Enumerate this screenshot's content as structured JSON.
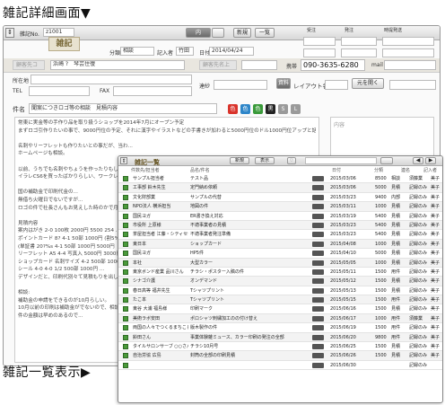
{
  "captions": {
    "detail": "雑記詳細画面▼",
    "list": "雑記一覧表示▶"
  },
  "detail": {
    "no_label": "雑記No.",
    "no_value": "z1001",
    "kind": "雑記",
    "buttons": {
      "b1": "内",
      "b2": "",
      "new": "新規",
      "list": "一覧"
    },
    "top_labels": {
      "juchu": "受注",
      "hatchu": "発注",
      "sakusei": "時提発送"
    },
    "bunrui_label": "分類",
    "bunrui_value": "相談",
    "kinyusha_label": "記入者",
    "kinyusha_value": "竹田",
    "date_label": "日付",
    "date_value": "2014/04/24",
    "customer_placeholder": "顧客先コ",
    "person_name": "浜崎 ?　琴芸住復",
    "addr_placeholder": "顧客先名上",
    "phone_label": "携帯",
    "phone_value": "090-3635-6280",
    "mail_label": "mail",
    "address_label": "所在地",
    "tel_label": "TEL",
    "fax_label": "FAX",
    "teiban_label": "達紗",
    "btn_shiryo": "資料",
    "layout_label": "レイアウト名",
    "btn_open": "元を開く",
    "subject_label": "件名",
    "subject_value": "聞案につきロゴ等の相談　見積内容",
    "memo_label": "内容",
    "colors": [
      {
        "label": "色",
        "hex": "#d9332b"
      },
      {
        "label": "色",
        "hex": "#2e86c9"
      },
      {
        "label": "色",
        "hex": "#3a9a3a"
      },
      {
        "label": "黒",
        "hex": "#222222"
      },
      {
        "label": "S",
        "hex": "#9a9a9a"
      },
      {
        "label": "L",
        "hex": "#9a9a9a"
      }
    ],
    "body_lines": [
      "常東に実金等の手作り品を取り扱うショップを2014年7月にオープン予定",
      "まずロゴ引作りたいの事で、9000円位の予定、それに漢字やイラストなどの手書きが加わると5000円位のドル1000円位アップと話した。",
      "",
      "名刺やリーフレットも作りたいとの事だが、当わ...",
      "ホームページも相談。",
      "",
      "以前、うちでも名刺やちょうを作ったりもし...",
      "イラレCS6を買ったばかりらしい、ワークレセ...",
      "",
      "国の補助金で印刷代金の...",
      "無借ち火曜日でないですが...",
      "ロゴの件で社長さんもお見えした時のかで月...",
      "",
      "見積内容",
      "案内はがき  2-0  100枚  2000円    5500   254 .",
      "ポイントカード  8?  4-1  50部  1000円  (割5%)",
      "(単証書  20?%s  4-1  50部  1000円  5000円",
      "リーフレット  A5  4-4  写真入  5000円  3000円",
      "ショップカード  名刺サイズ  4-2  500部  1000円",
      "シール  4-0  4-0 1/2  500部  1000円 ...",
      "デザインだと、印刷代別々て見積もりを出して...",
      "",
      "相談:",
      "補助金の申請をできるのが10月らしい。",
      "10月以前の印刷は補助金がでないので、相談...",
      "件の金額は早めのあるので..."
    ]
  },
  "list": {
    "title": "雑記一覧",
    "new_button": "新規",
    "detail_button": "表示",
    "columns": [
      "件数先/担当者",
      "品名/件名",
      "日付",
      "分類",
      "連名",
      "記入者"
    ],
    "rows": [
      {
        "c1": "サンプル担当者",
        "c2": "テスト品",
        "date": "2015/03/06",
        "bunrui": "8500",
        "type": "相談",
        "person": "須藤業",
        "extra": "美子"
      },
      {
        "c1": "工事部  鈴木先生",
        "c2": "定門納め依頼",
        "date": "2015/03/06",
        "bunrui": "5000",
        "type": "見積",
        "person": "記録のみ",
        "extra": "美子"
      },
      {
        "c1": "文化財部業",
        "c2": "サンプルの代替",
        "date": "2015/03/23",
        "bunrui": "9400",
        "type": "内部",
        "person": "記録のみ",
        "extra": "美子"
      },
      {
        "c1": "NPO法人  横浜担当",
        "c2": "地図の件",
        "date": "2015/03/11",
        "bunrui": "1000",
        "type": "見積",
        "person": "記録のみ",
        "extra": "美子"
      },
      {
        "c1": "国民ヨガ",
        "c2": "ER書き換え対応",
        "date": "2015/03/19",
        "bunrui": "5400",
        "type": "見積",
        "person": "記録のみ",
        "extra": "美子"
      },
      {
        "c1": "市役所  上原様",
        "c2": "不適事業者の見積",
        "date": "2015/03/23",
        "bunrui": "5400",
        "type": "見積",
        "person": "記録のみ",
        "extra": "美子"
      },
      {
        "c1": "茶屋担当者  江藤・シティセール",
        "c2": "不適事業者発注準備",
        "date": "2015/03/23",
        "bunrui": "5400",
        "type": "見積",
        "person": "記録のみ",
        "extra": "美子"
      },
      {
        "c1": "東日本",
        "c2": "ショップカード",
        "date": "2015/04/08",
        "bunrui": "1000",
        "type": "見積",
        "person": "記録のみ",
        "extra": "美子"
      },
      {
        "c1": "国民ヨガ",
        "c2": "HP5件",
        "date": "2015/04/10",
        "bunrui": "5000",
        "type": "見積",
        "person": "記録のみ",
        "extra": "美子"
      },
      {
        "c1": "本社",
        "c2": "大型カラー",
        "date": "2015/05/05",
        "bunrui": "1000",
        "type": "見積",
        "person": "記録のみ",
        "extra": "美子"
      },
      {
        "c1": "東京ボンド産業  品川さん",
        "c2": "チラシ・ポスター入稿の件",
        "date": "2015/05/11",
        "bunrui": "1500",
        "type": "用件",
        "person": "記録のみ",
        "extra": "美子"
      },
      {
        "c1": "シナゴ介護",
        "c2": "オンデマンド",
        "date": "2015/05/12",
        "bunrui": "1500",
        "type": "見積",
        "person": "記録のみ",
        "extra": "美子"
      },
      {
        "c1": "春日高等  福井先生",
        "c2": "Tシャツプリント",
        "date": "2015/05/13",
        "bunrui": "1500",
        "type": "見積",
        "person": "記録のみ",
        "extra": "美子"
      },
      {
        "c1": "たこ本",
        "c2": "Tシャツプリント",
        "date": "2015/05/15",
        "bunrui": "1500",
        "type": "用件",
        "person": "記録のみ",
        "extra": "美子"
      },
      {
        "c1": "東谷  大浦  福島様",
        "c2": "印刷マーク",
        "date": "2015/06/16",
        "bunrui": "1500",
        "type": "見積",
        "person": "記録のみ",
        "extra": "美子"
      },
      {
        "c1": "美術ラボ安田",
        "c2": "ポロシャツ刺繍加工のの付け替え",
        "date": "2015/06/17",
        "bunrui": "1000",
        "type": "用件",
        "person": "須藤業",
        "extra": "美子"
      },
      {
        "c1": "両国の人々でつくるまちこと",
        "c2": "版木製作の件",
        "date": "2015/06/19",
        "bunrui": "1500",
        "type": "用件",
        "person": "記録のみ",
        "extra": "美子"
      },
      {
        "c1": "鈴田さん",
        "c2": "事業体験雑ミュース、カラー印刷の発注の全部",
        "date": "2015/06/20",
        "bunrui": "9800",
        "type": "用件",
        "person": "記録のみ",
        "extra": "美子"
      },
      {
        "c1": "タイルサロンサーブ  ○○さん",
        "c2": "チラシ10月号",
        "date": "2015/06/25",
        "bunrui": "1500",
        "type": "見積",
        "person": "記録のみ",
        "extra": "美子"
      },
      {
        "c1": "自治労協  広島",
        "c2": "封筒の全部の印刷見積",
        "date": "2015/06/26",
        "bunrui": "1500",
        "type": "見積",
        "person": "記録のみ",
        "extra": "美子"
      },
      {
        "c1": "",
        "c2": "",
        "date": "2015/06/30",
        "bunrui": "",
        "type": "",
        "person": "記録のみ",
        "extra": ""
      }
    ]
  }
}
